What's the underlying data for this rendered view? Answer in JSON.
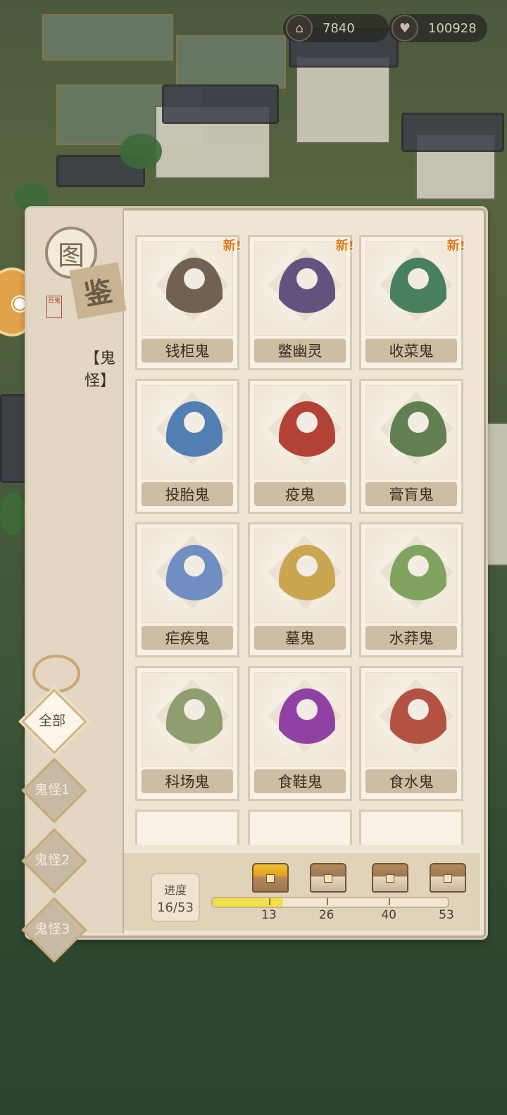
{
  "currency": [
    {
      "icon": "building-icon",
      "value": "7840"
    },
    {
      "icon": "heart-icon",
      "value": "100928"
    }
  ],
  "panel": {
    "title_glyph_1": "图",
    "title_glyph_2": "鉴",
    "seal_text": "百鬼",
    "category_label": "【鬼怪】"
  },
  "filters": [
    {
      "label": "全部",
      "active": true
    },
    {
      "label": "鬼怪1",
      "active": false
    },
    {
      "label": "鬼怪2",
      "active": false
    },
    {
      "label": "鬼怪3",
      "active": false
    }
  ],
  "cards": [
    {
      "name": "钱柜鬼",
      "new": true,
      "new_label": "新!",
      "color": "#6b5a4a"
    },
    {
      "name": "鳖幽灵",
      "new": true,
      "new_label": "新!",
      "color": "#5b4a7a"
    },
    {
      "name": "收菜鬼",
      "new": true,
      "new_label": "新!",
      "color": "#3f7a5a"
    },
    {
      "name": "投胎鬼",
      "new": false,
      "new_label": "",
      "color": "#4a7ab0"
    },
    {
      "name": "疫鬼",
      "new": false,
      "new_label": "",
      "color": "#b03a2e"
    },
    {
      "name": "膏肓鬼",
      "new": false,
      "new_label": "",
      "color": "#5a7a4a"
    },
    {
      "name": "疟疾鬼",
      "new": false,
      "new_label": "",
      "color": "#6a8ac0"
    },
    {
      "name": "墓鬼",
      "new": false,
      "new_label": "",
      "color": "#c8a34a"
    },
    {
      "name": "水莽鬼",
      "new": false,
      "new_label": "",
      "color": "#7aa05a"
    },
    {
      "name": "科场鬼",
      "new": false,
      "new_label": "",
      "color": "#8a9a6a"
    },
    {
      "name": "食鞋鬼",
      "new": false,
      "new_label": "",
      "color": "#8a3aa0"
    },
    {
      "name": "食水鬼",
      "new": false,
      "new_label": "",
      "color": "#b04a3a"
    }
  ],
  "progress": {
    "label": "进度",
    "value": "16/53",
    "fraction": 0.3,
    "milestones": [
      "13",
      "26",
      "40",
      "53"
    ],
    "milestone_fractions": [
      0.245,
      0.49,
      0.755,
      1.0
    ]
  }
}
